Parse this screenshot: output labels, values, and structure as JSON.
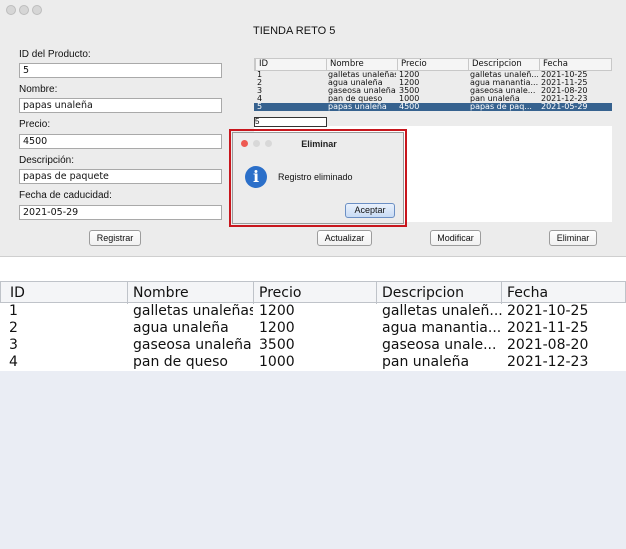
{
  "window": {
    "title": "TIENDA RETO 5",
    "form": {
      "id_label": "ID del Producto:",
      "id_value": "5",
      "name_label": "Nombre:",
      "name_value": "papas unaleña",
      "price_label": "Precio:",
      "price_value": "4500",
      "desc_label": "Descripción:",
      "desc_value": "papas de paquete",
      "date_label": "Fecha de caducidad:",
      "date_value": "2021-05-29"
    },
    "buttons": {
      "register": "Registrar",
      "update": "Actualizar",
      "modify": "Modificar",
      "delete": "Eliminar"
    },
    "table": {
      "headers": [
        "ID",
        "Nombre",
        "Precio",
        "Descripcion",
        "Fecha"
      ],
      "rows": [
        [
          "1",
          "galletas unaleñas",
          "1200",
          "galletas unaleñ...",
          "2021-10-25"
        ],
        [
          "2",
          "agua unaleña",
          "1200",
          "agua manantia...",
          "2021-11-25"
        ],
        [
          "3",
          "gaseosa unaleña",
          "3500",
          "gaseosa unale...",
          "2021-08-20"
        ],
        [
          "4",
          "pan de queso",
          "1000",
          "pan unaleña",
          "2021-12-23"
        ],
        [
          "5",
          "papas unaleña",
          "4500",
          "papas de paq...",
          "2021-05-29"
        ]
      ],
      "selected_row": 4
    }
  },
  "dialog": {
    "title": "Eliminar",
    "message": "Registro eliminado",
    "ok_label": "Aceptar",
    "icon": "info-icon",
    "highlight_color": "#c8161d"
  },
  "zoom_table": {
    "headers": [
      "ID",
      "Nombre",
      "Precio",
      "Descripcion",
      "Fecha"
    ],
    "rows": [
      [
        "1",
        "galletas unaleñas",
        "1200",
        "galletas unaleñ...",
        "2021-10-25"
      ],
      [
        "2",
        "agua unaleña",
        "1200",
        "agua manantia...",
        "2021-11-25"
      ],
      [
        "3",
        "gaseosa unaleña",
        "3500",
        "gaseosa unale...",
        "2021-08-20"
      ],
      [
        "4",
        "pan de queso",
        "1000",
        "pan unaleña",
        "2021-12-23"
      ]
    ]
  }
}
